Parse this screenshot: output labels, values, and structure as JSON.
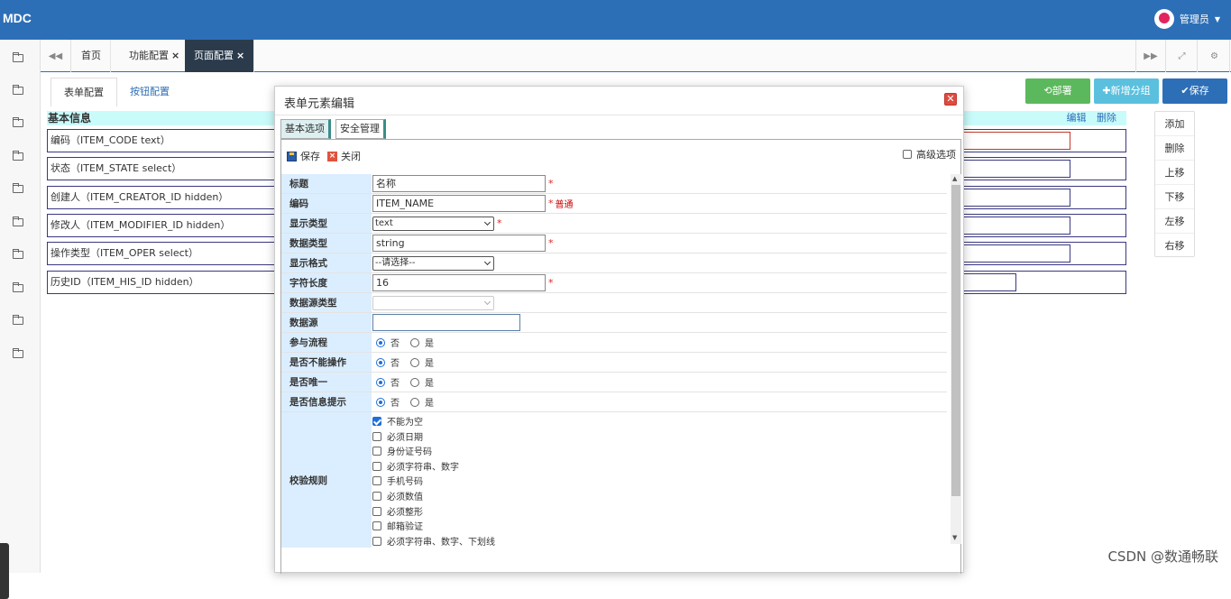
{
  "app": {
    "logo": "MDC",
    "user": "管理员"
  },
  "page_tabs": [
    {
      "label": "首页",
      "closable": false
    },
    {
      "label": "功能配置",
      "closable": true
    },
    {
      "label": "页面配置",
      "closable": true
    }
  ],
  "sub_tabs": [
    "表单配置",
    "按钮配置"
  ],
  "section": {
    "title": "基本信息",
    "edit": "编辑",
    "delete": "删除"
  },
  "fields": [
    "编码（ITEM_CODE  text）",
    "状态（ITEM_STATE  select）",
    "创建人（ITEM_CREATOR_ID  hidden）",
    "修改人（ITEM_MODIFIER_ID  hidden）",
    "操作类型（ITEM_OPER  select）",
    "历史ID（ITEM_HIS_ID  hidden）"
  ],
  "actions": {
    "deploy": "部署",
    "add_group": "新增分组",
    "save": "保存"
  },
  "actions_colors": {
    "deploy": "#5cb85c",
    "add_group": "#5bc0de",
    "save": "#2d6fb7"
  },
  "right_panel": [
    "添加",
    "删除",
    "上移",
    "下移",
    "左移",
    "右移"
  ],
  "modal": {
    "title": "表单元素编辑",
    "tabs": [
      "基本选项",
      "安全管理"
    ],
    "toolbar": {
      "save": "保存",
      "close": "关闭",
      "advanced": "高级选项"
    },
    "rows": {
      "title": {
        "label": "标题",
        "value": "名称"
      },
      "code": {
        "label": "编码",
        "value": "ITEM_NAME",
        "hint": "普通"
      },
      "display_type": {
        "label": "显示类型",
        "value": "text"
      },
      "data_type": {
        "label": "数据类型",
        "value": "string"
      },
      "display_format": {
        "label": "显示格式",
        "value": "--请选择--"
      },
      "length": {
        "label": "字符长度",
        "value": "16"
      },
      "ds_type": {
        "label": "数据源类型",
        "value": ""
      },
      "ds": {
        "label": "数据源",
        "value": ""
      },
      "flow": {
        "label": "参与流程"
      },
      "readonly": {
        "label": "是否不能操作"
      },
      "unique": {
        "label": "是否唯一"
      },
      "info": {
        "label": "是否信息提示"
      },
      "validate": {
        "label": "校验规则"
      }
    },
    "radio_no": "否",
    "radio_yes": "是",
    "required_mark": "*",
    "validations": [
      {
        "label": "不能为空",
        "checked": true
      },
      {
        "label": "必须日期",
        "checked": false
      },
      {
        "label": "身份证号码",
        "checked": false
      },
      {
        "label": "必须字符串、数字",
        "checked": false
      },
      {
        "label": "手机号码",
        "checked": false
      },
      {
        "label": "必须数值",
        "checked": false
      },
      {
        "label": "必须整形",
        "checked": false
      },
      {
        "label": "邮箱验证",
        "checked": false
      },
      {
        "label": "必须字符串、数字、下划线",
        "checked": false
      }
    ]
  },
  "watermark": "CSDN @数通畅联"
}
